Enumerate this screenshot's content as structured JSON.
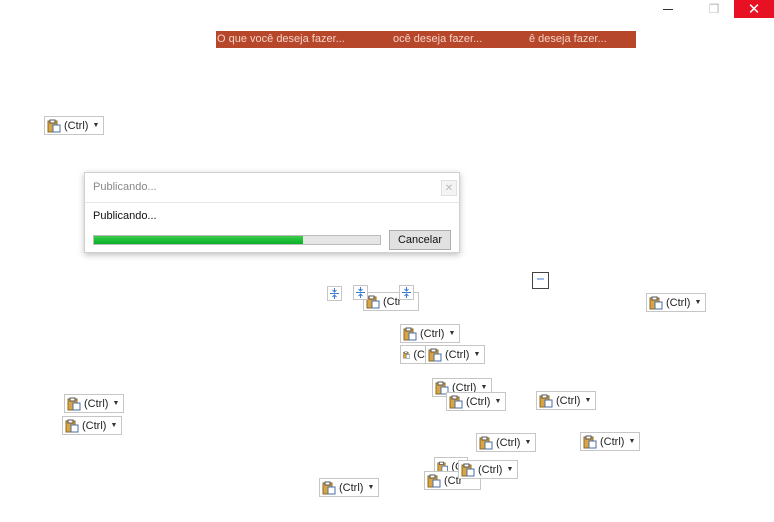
{
  "window": {
    "minimize_icon": "minimize-icon",
    "restore_icon": "restore-icon",
    "close_icon": "close-icon",
    "close_glyph": "✕",
    "restore_glyph": "❐"
  },
  "searchbar": {
    "color": "#b7472a",
    "prompts": [
      "O que você deseja fazer...",
      "ocê deseja fazer...",
      "ê deseja fazer..."
    ]
  },
  "paste_button": {
    "label": "(Ctrl)",
    "partial_labels": [
      "(Ctrl)",
      "(Ctr",
      "(C",
      "(Ctrl)"
    ],
    "icon": "paste-clipboard-icon"
  },
  "dialog": {
    "title": "Publicando...",
    "status": "Publicando...",
    "progress_percent": 73,
    "cancel_label": "Cancelar",
    "progress_color": "#06b025"
  }
}
